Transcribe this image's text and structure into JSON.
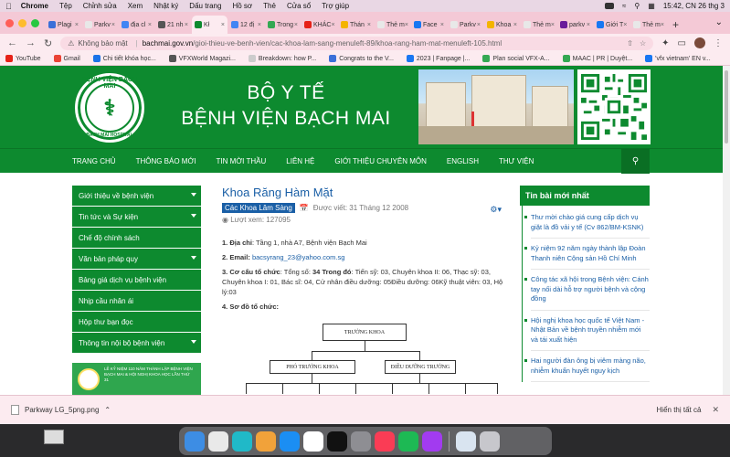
{
  "menubar": {
    "app": "Chrome",
    "items": [
      "Tệp",
      "Chỉnh sửa",
      "Xem",
      "Nhật ký",
      "Dấu trang",
      "Hồ sơ",
      "Thẻ",
      "Cửa sổ",
      "Trợ giúp"
    ],
    "clock": "15:42, CN 26 thg 3"
  },
  "tabs": [
    {
      "label": "Plagi",
      "color": "#3b6fd8"
    },
    {
      "label": "Parkv",
      "color": "#e8e8e8"
    },
    {
      "label": "địa cl",
      "color": "#4285f4"
    },
    {
      "label": "21 nh",
      "color": "#555555"
    },
    {
      "label": "Kł",
      "color": "#0d8a2f",
      "active": true
    },
    {
      "label": "12 đị",
      "color": "#4285f4"
    },
    {
      "label": "Trong",
      "color": "#34a853"
    },
    {
      "label": "KHÁC",
      "color": "#e62117"
    },
    {
      "label": "Thán",
      "color": "#f4b400"
    },
    {
      "label": "Thẻ m",
      "color": "#e8e8e8"
    },
    {
      "label": "Face",
      "color": "#1877f2"
    },
    {
      "label": "Parkv",
      "color": "#e8e8e8"
    },
    {
      "label": "Khoa",
      "color": "#f4b400"
    },
    {
      "label": "Thẻ m",
      "color": "#e8e8e8"
    },
    {
      "label": "parkv",
      "color": "#6a1b9a"
    },
    {
      "label": "Giới T",
      "color": "#1877f2"
    },
    {
      "label": "Thẻ m",
      "color": "#e8e8e8"
    }
  ],
  "toolbar": {
    "security": "Không bảo mật",
    "url_domain": "bachmai.gov.vn",
    "url_path": "/gioi-thieu-ve-benh-vien/cac-khoa-lam-sang-menuleft-89/khoa-rang-ham-mat-menuleft-105.html"
  },
  "bookmarks": [
    {
      "label": "YouTube",
      "color": "#e62117"
    },
    {
      "label": "Gmail",
      "color": "#ea4335"
    },
    {
      "label": "Chi tiết khóa học...",
      "color": "#1a73e8"
    },
    {
      "label": "VFXWorld Magazi...",
      "color": "#555555"
    },
    {
      "label": "Breakdown: how P...",
      "color": "#cccccc"
    },
    {
      "label": "Congrats to the V...",
      "color": "#3b6fd8"
    },
    {
      "label": "2023 | Fanpage |...",
      "color": "#1877f2"
    },
    {
      "label": "Plan social VFX-A...",
      "color": "#34a853"
    },
    {
      "label": "MAAC | PR | Duyệt...",
      "color": "#34a853"
    },
    {
      "label": "'vfx vietnam' EN v...",
      "color": "#1877f2"
    }
  ],
  "header": {
    "logo_top": "BỆNH VIỆN BẠCH MAI",
    "logo_bottom": "BACH MAI HOSPITAL",
    "title_line1": "BỘ Y TẾ",
    "title_line2": "BỆNH VIỆN BẠCH MAI"
  },
  "nav": [
    "TRANG CHỦ",
    "THÔNG BÁO MỚI",
    "TIN MỜI THẦU",
    "LIÊN HỆ",
    "GIỚI THIỆU CHUYÊN MÔN",
    "ENGLISH",
    "THƯ VIỆN"
  ],
  "sidebar": [
    {
      "label": "Giới thiệu về bệnh viện",
      "caret": true
    },
    {
      "label": "Tin tức và Sự kiện",
      "caret": true
    },
    {
      "label": "Chế độ chính sách",
      "caret": false
    },
    {
      "label": "Văn bản pháp quy",
      "caret": true
    },
    {
      "label": "Bảng giá dịch vụ bệnh viện",
      "caret": false
    },
    {
      "label": "Nhịp cầu nhân ái",
      "caret": false
    },
    {
      "label": "Hộp thư bạn đọc",
      "caret": false
    },
    {
      "label": "Thông tin nội bộ bệnh viện",
      "caret": true
    }
  ],
  "banner": {
    "text": "LỄ KỶ NIỆM 110 NĂM THÀNH LẬP BỆNH VIỆN BẠCH MAI & HỘI NGHỊ KHOA HỌC LẦN THỨ 31"
  },
  "article": {
    "title": "Khoa Răng Hàm Mặt",
    "category": "Các Khoa Lâm Sàng",
    "written": "Được viết: 31 Tháng 12 2008",
    "views": "Lượt xem: 127095",
    "p1_label": "1. Địa chỉ",
    "p1_text": ": Tầng 1, nhà A7, Bệnh viện Bạch Mai",
    "p2_label": "2. Email:",
    "p2_email": "bacsyrang_23@yahoo.com.sg",
    "p3_label": "3. Cơ cấu tổ chức",
    "p3_text_a": ": Tổng  số: ",
    "p3_bold": "34 Trong đó",
    "p3_text_b": ": Tiến sỹ: 03, Chuyên khoa II: 06, Thạc sỹ: 03, Chuyên khoa I: 01, Bác sĩ: 04, Cử nhân điều dưỡng: 05Điều dưỡng:  06Kỹ thuật viên: 03, Hộ lý:03",
    "p4_label": "4. Sơ đồ tổ chức:",
    "org_head": "TRƯỞNG KHOA",
    "org_deputy": "PHÓ TRƯỞNG KHOA",
    "org_nurse": "ĐIỀU DƯỠNG TRƯỞNG"
  },
  "news": {
    "heading": "Tin bài mới nhất",
    "items": [
      "Thư mời chào giá cung cấp dịch vụ giặt là đồ vải y tế (Cv 862/BM-KSNK)",
      "Kỷ niệm 92 năm ngày thành lập Đoàn Thanh niên Cộng sản Hồ Chí Minh",
      "Công tác xã hội trong Bệnh viện: Cánh tay nối dài hỗ trợ người bệnh và cộng đồng",
      "Hội nghị khoa học quốc tế Việt Nam - Nhật Bản về bệnh truyền nhiễm mới và tái xuất hiện",
      "Hai người đàn ông bị viêm màng não, nhiễm khuẩn huyết nguy kịch"
    ]
  },
  "downloads": {
    "file": "Parkway LG_5png.png",
    "show_all": "Hiển thị tất cả"
  },
  "dock": [
    {
      "name": "finder",
      "color": "#3d8de4"
    },
    {
      "name": "chrome",
      "color": "#e9e9e9"
    },
    {
      "name": "canva",
      "color": "#20b9c8"
    },
    {
      "name": "photos",
      "color": "#f1a23a"
    },
    {
      "name": "app-store",
      "color": "#1b8ef3"
    },
    {
      "name": "notion",
      "color": "#ffffff"
    },
    {
      "name": "capcut",
      "color": "#111111"
    },
    {
      "name": "system-settings",
      "color": "#8e8e93"
    },
    {
      "name": "music",
      "color": "#fa3c55"
    },
    {
      "name": "spotify",
      "color": "#1db954"
    },
    {
      "name": "messenger",
      "color": "#a23bf0"
    },
    {
      "name": "sep",
      "color": ""
    },
    {
      "name": "preview",
      "color": "#d9e4f0"
    },
    {
      "name": "trash",
      "color": "#c7c7cc"
    }
  ]
}
